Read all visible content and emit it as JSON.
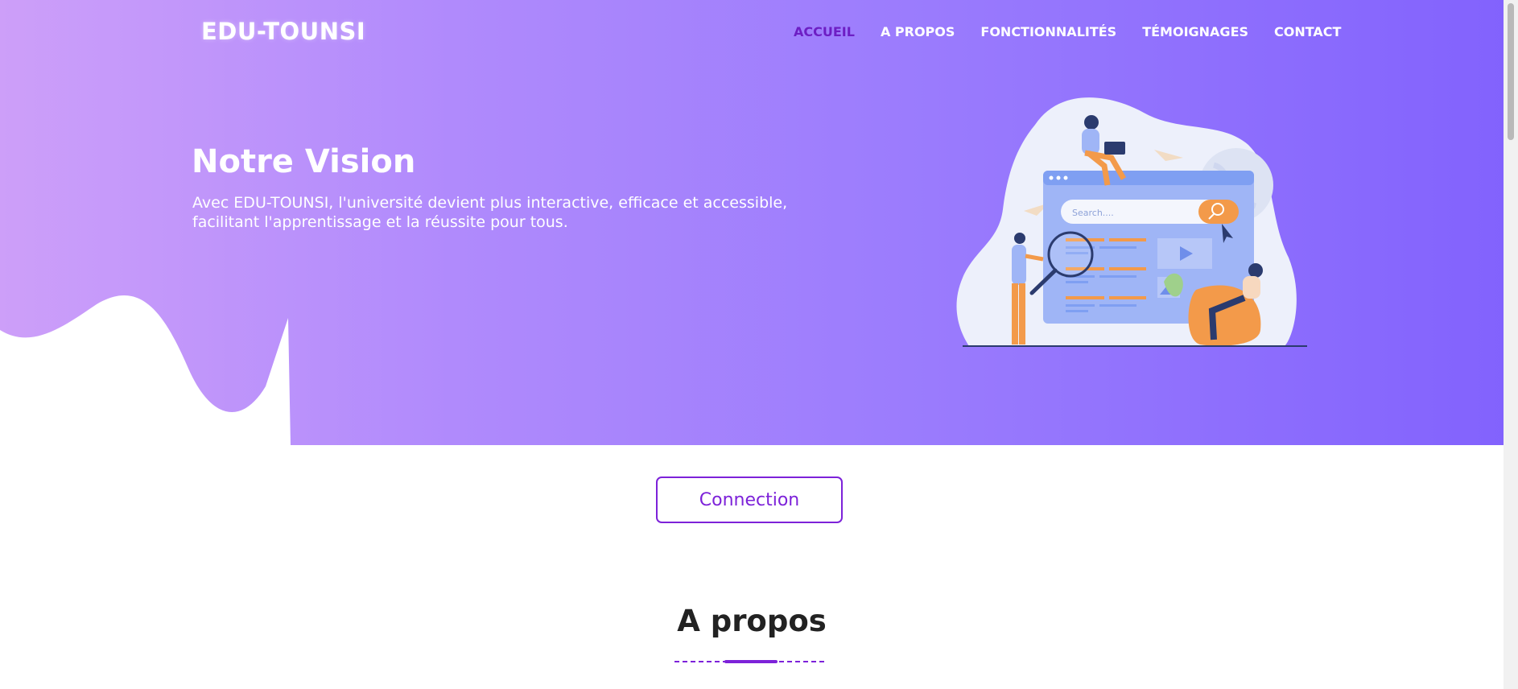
{
  "brand": {
    "name": "EDU-TOUNSI"
  },
  "nav": {
    "items": [
      {
        "label": "ACCUEIL",
        "active": true
      },
      {
        "label": "A PROPOS",
        "active": false
      },
      {
        "label": "FONCTIONNALITÉS",
        "active": false
      },
      {
        "label": "TÉMOIGNAGES",
        "active": false
      },
      {
        "label": "CONTACT",
        "active": false
      }
    ]
  },
  "hero": {
    "title": "Notre Vision",
    "text": "Avec EDU-TOUNSI, l'université devient plus interactive, efficace et accessible, facilitant l'apprentissage et la réussite pour tous.",
    "illustration": {
      "search_placeholder": "Search....",
      "icons": [
        "search-icon",
        "play-icon",
        "image-icon",
        "globe-icon",
        "paper-plane-icon",
        "cursor-icon",
        "magnifier-icon"
      ]
    }
  },
  "cta": {
    "connect_label": "Connection"
  },
  "about": {
    "title": "A propos",
    "snippet": ""
  },
  "colors": {
    "gradient_start": "#cd9ff9",
    "gradient_end": "#8262fd",
    "nav_active": "#6d1ec4",
    "button_accent": "#7d22d9",
    "illustration_orange": "#f39a4a",
    "illustration_blue": "#8fabf4"
  }
}
